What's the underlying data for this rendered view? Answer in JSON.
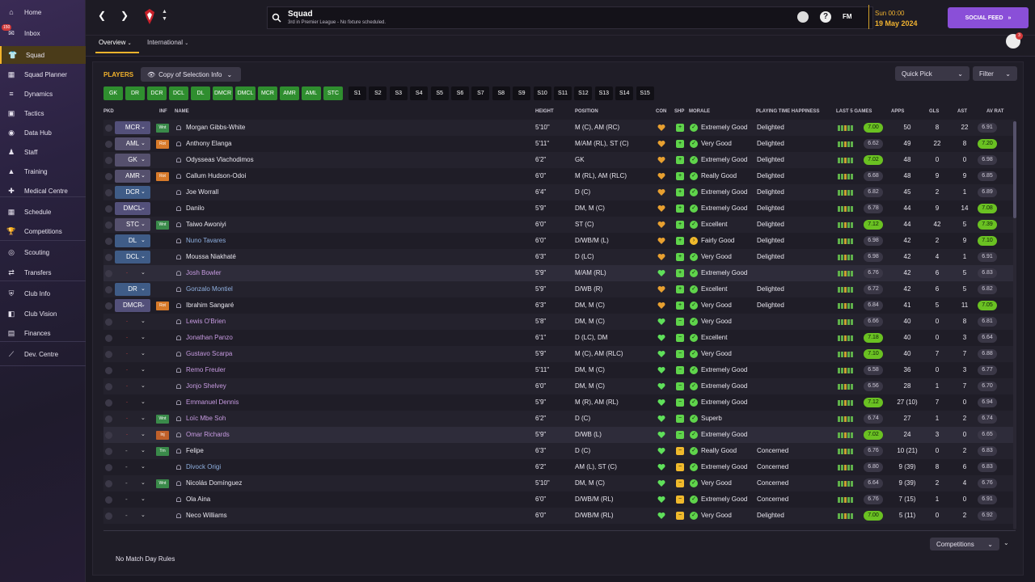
{
  "sidebar": {
    "items": [
      {
        "label": "Home",
        "icon": "home-icon"
      },
      {
        "label": "Inbox",
        "icon": "inbox-icon",
        "badge": "150"
      },
      {
        "label": "Squad",
        "icon": "squad-icon",
        "active": true
      },
      {
        "label": "Squad Planner",
        "icon": "squad-planner-icon"
      },
      {
        "label": "Dynamics",
        "icon": "dynamics-icon"
      },
      {
        "label": "Tactics",
        "icon": "tactics-icon"
      },
      {
        "label": "Data Hub",
        "icon": "data-hub-icon"
      },
      {
        "label": "Staff",
        "icon": "staff-icon"
      },
      {
        "label": "Training",
        "icon": "training-icon"
      },
      {
        "label": "Medical Centre",
        "icon": "medical-icon"
      },
      {
        "label": "Schedule",
        "icon": "schedule-icon"
      },
      {
        "label": "Competitions",
        "icon": "trophy-icon"
      },
      {
        "label": "Scouting",
        "icon": "scouting-icon"
      },
      {
        "label": "Transfers",
        "icon": "transfers-icon"
      },
      {
        "label": "Club Info",
        "icon": "club-info-icon"
      },
      {
        "label": "Club Vision",
        "icon": "club-vision-icon"
      },
      {
        "label": "Finances",
        "icon": "finances-icon"
      },
      {
        "label": "Dev. Centre",
        "icon": "dev-centre-icon"
      }
    ]
  },
  "header": {
    "title": "Squad",
    "subtitle": "3rd in Premier League - No fixture scheduled.",
    "fm_label": "FM",
    "date_line1": "Sun 00:00",
    "date_line2": "19 May 2024",
    "social_feed": "SOCIAL FEED",
    "notif_count": "3"
  },
  "tabs": {
    "overview": "Overview",
    "international": "International"
  },
  "panel": {
    "players_label": "PLAYERS",
    "selection_info": "Copy of Selection Info",
    "quick_pick": "Quick Pick",
    "filter": "Filter",
    "competitions": "Competitions",
    "footer_text": "No Match Day Rules"
  },
  "formation_buttons": [
    "GK",
    "DR",
    "DCR",
    "DCL",
    "DL",
    "DMCR",
    "DMCL",
    "MCR",
    "AMR",
    "AML",
    "STC"
  ],
  "sub_buttons": [
    "S1",
    "S2",
    "S3",
    "S4",
    "S5",
    "S6",
    "S7",
    "S8",
    "S9",
    "S10",
    "S11",
    "S12",
    "S13",
    "S14",
    "S15"
  ],
  "columns": {
    "pkd": "PKD",
    "inf": "INF",
    "name": "NAME",
    "height": "HEIGHT",
    "position": "POSITION",
    "con": "CON",
    "shp": "SHP",
    "morale": "MORALE",
    "pth": "PLAYING TIME HAPPINESS",
    "last5": "LAST 5 GAMES",
    "apps": "APPS",
    "gls": "GLS",
    "ast": "AST",
    "avrat": "AV RAT"
  },
  "colors": {
    "accent": "#f3b32c",
    "social": "#8a4fd8",
    "pos_defense": "#3f5c87",
    "pos_mid": "#53507a",
    "pos_attack": "#55506d",
    "green": "#2f8e2f",
    "rating_green": "#6ac122"
  },
  "players": [
    {
      "pkd": "MCR",
      "inf": "Wnt",
      "name": "Morgan Gibbs-White",
      "height": "5'10\"",
      "position": "M (C), AM (RC)",
      "morale": "Extremely Good",
      "pth": "Delighted",
      "rating": "7.00",
      "rating_hi": true,
      "apps": "50",
      "gls": "8",
      "ast": "22",
      "avrat": "6.91",
      "avrat_hi": false
    },
    {
      "pkd": "AML",
      "inf": "Rot",
      "name": "Anthony Elanga",
      "height": "5'11\"",
      "position": "M/AM (RL), ST (C)",
      "morale": "Very Good",
      "pth": "Delighted",
      "rating": "6.62",
      "rating_hi": false,
      "apps": "49",
      "gls": "22",
      "ast": "8",
      "avrat": "7.20",
      "avrat_hi": true
    },
    {
      "pkd": "GK",
      "inf": "",
      "name": "Odysseas Vlachodimos",
      "height": "6'2\"",
      "position": "GK",
      "morale": "Extremely Good",
      "pth": "Delighted",
      "rating": "7.02",
      "rating_hi": true,
      "apps": "48",
      "gls": "0",
      "ast": "0",
      "avrat": "6.98",
      "avrat_hi": false
    },
    {
      "pkd": "AMR",
      "inf": "Rot",
      "name": "Callum Hudson-Odoi",
      "height": "6'0\"",
      "position": "M (RL), AM (RLC)",
      "morale": "Really Good",
      "pth": "Delighted",
      "rating": "6.68",
      "rating_hi": false,
      "apps": "48",
      "gls": "9",
      "ast": "9",
      "avrat": "6.85",
      "avrat_hi": false
    },
    {
      "pkd": "DCR",
      "inf": "",
      "name": "Joe Worrall",
      "height": "6'4\"",
      "position": "D (C)",
      "morale": "Extremely Good",
      "pth": "Delighted",
      "rating": "6.82",
      "rating_hi": false,
      "apps": "45",
      "gls": "2",
      "ast": "1",
      "avrat": "6.89",
      "avrat_hi": false
    },
    {
      "pkd": "DMCL",
      "inf": "",
      "name": "Danilo",
      "height": "5'9\"",
      "position": "DM, M (C)",
      "morale": "Extremely Good",
      "pth": "Delighted",
      "rating": "6.78",
      "rating_hi": false,
      "apps": "44",
      "gls": "9",
      "ast": "14",
      "avrat": "7.08",
      "avrat_hi": true
    },
    {
      "pkd": "STC",
      "inf": "Wnt",
      "name": "Taiwo Awoniyi",
      "height": "6'0\"",
      "position": "ST (C)",
      "morale": "Excellent",
      "pth": "Delighted",
      "rating": "7.12",
      "rating_hi": true,
      "apps": "44",
      "gls": "42",
      "ast": "5",
      "avrat": "7.39",
      "avrat_hi": true
    },
    {
      "pkd": "DL",
      "inf": "",
      "name": "Nuno Tavares",
      "height": "6'0\"",
      "position": "D/WB/M (L)",
      "morale": "Fairly Good",
      "pth": "Delighted",
      "rating": "6.98",
      "rating_hi": false,
      "apps": "42",
      "gls": "2",
      "ast": "9",
      "avrat": "7.10",
      "avrat_hi": true,
      "loan": true
    },
    {
      "pkd": "DCL",
      "inf": "",
      "name": "Moussa Niakhaté",
      "height": "6'3\"",
      "position": "D (LC)",
      "morale": "Very Good",
      "pth": "Delighted",
      "rating": "6.98",
      "rating_hi": false,
      "apps": "42",
      "gls": "4",
      "ast": "1",
      "avrat": "6.91",
      "avrat_hi": false
    },
    {
      "pkd": "",
      "inf": "",
      "name": "Josh Bowler",
      "height": "5'9\"",
      "position": "M/AM (RL)",
      "morale": "Extremely Good",
      "pth": "",
      "rating": "6.76",
      "rating_hi": false,
      "apps": "42",
      "gls": "6",
      "ast": "5",
      "avrat": "6.83",
      "avrat_hi": false,
      "loan": true
    },
    {
      "pkd": "DR",
      "inf": "",
      "name": "Gonzalo Montiel",
      "height": "5'9\"",
      "position": "D/WB (R)",
      "morale": "Excellent",
      "pth": "Delighted",
      "rating": "6.72",
      "rating_hi": false,
      "apps": "42",
      "gls": "6",
      "ast": "5",
      "avrat": "6.82",
      "avrat_hi": false,
      "loan": true
    },
    {
      "pkd": "DMCR",
      "inf": "Rot",
      "name": "Ibrahim Sangaré",
      "height": "6'3\"",
      "position": "DM, M (C)",
      "morale": "Very Good",
      "pth": "Delighted",
      "rating": "6.84",
      "rating_hi": false,
      "apps": "41",
      "gls": "5",
      "ast": "11",
      "avrat": "7.05",
      "avrat_hi": true
    },
    {
      "pkd": "",
      "inf": "",
      "name": "Lewis O'Brien",
      "height": "5'8\"",
      "position": "DM, M (C)",
      "morale": "Very Good",
      "pth": "",
      "rating": "6.66",
      "rating_hi": false,
      "apps": "40",
      "gls": "0",
      "ast": "8",
      "avrat": "6.81",
      "avrat_hi": false,
      "loan": true
    },
    {
      "pkd": "",
      "inf": "",
      "name": "Jonathan Panzo",
      "height": "6'1\"",
      "position": "D (LC), DM",
      "morale": "Excellent",
      "pth": "",
      "rating": "7.18",
      "rating_hi": true,
      "apps": "40",
      "gls": "0",
      "ast": "3",
      "avrat": "6.64",
      "avrat_hi": false,
      "loan": true
    },
    {
      "pkd": "",
      "inf": "",
      "name": "Gustavo Scarpa",
      "height": "5'9\"",
      "position": "M (C), AM (RLC)",
      "morale": "Very Good",
      "pth": "",
      "rating": "7.10",
      "rating_hi": true,
      "apps": "40",
      "gls": "7",
      "ast": "7",
      "avrat": "6.88",
      "avrat_hi": false,
      "loan": true
    },
    {
      "pkd": "",
      "inf": "",
      "name": "Remo Freuler",
      "height": "5'11\"",
      "position": "DM, M (C)",
      "morale": "Extremely Good",
      "pth": "",
      "rating": "6.58",
      "rating_hi": false,
      "apps": "36",
      "gls": "0",
      "ast": "3",
      "avrat": "6.77",
      "avrat_hi": false,
      "loan": true
    },
    {
      "pkd": "",
      "inf": "",
      "name": "Jonjo Shelvey",
      "height": "6'0\"",
      "position": "DM, M (C)",
      "morale": "Extremely Good",
      "pth": "",
      "rating": "6.56",
      "rating_hi": false,
      "apps": "28",
      "gls": "1",
      "ast": "7",
      "avrat": "6.70",
      "avrat_hi": false,
      "loan": true
    },
    {
      "pkd": "",
      "inf": "",
      "name": "Emmanuel Dennis",
      "height": "5'9\"",
      "position": "M (R), AM (RL)",
      "morale": "Extremely Good",
      "pth": "",
      "rating": "7.12",
      "rating_hi": true,
      "apps": "27 (10)",
      "gls": "7",
      "ast": "0",
      "avrat": "6.94",
      "avrat_hi": false,
      "loan": true
    },
    {
      "pkd": "",
      "inf": "Wnt",
      "name": "Loïc Mbe Soh",
      "height": "6'2\"",
      "position": "D (C)",
      "morale": "Superb",
      "pth": "",
      "rating": "6.74",
      "rating_hi": false,
      "apps": "27",
      "gls": "1",
      "ast": "2",
      "avrat": "6.74",
      "avrat_hi": false,
      "loan": true
    },
    {
      "pkd": "",
      "inf": "Inj",
      "name": "Omar Richards",
      "height": "5'9\"",
      "position": "D/WB (L)",
      "morale": "Extremely Good",
      "pth": "",
      "rating": "7.02",
      "rating_hi": true,
      "apps": "24",
      "gls": "3",
      "ast": "0",
      "avrat": "6.65",
      "avrat_hi": false,
      "loan": true
    },
    {
      "pkd": "-",
      "inf": "Trn",
      "name": "Felipe",
      "height": "6'3\"",
      "position": "D (C)",
      "morale": "Really Good",
      "pth": "Concerned",
      "rating": "6.76",
      "rating_hi": false,
      "apps": "10 (21)",
      "gls": "0",
      "ast": "2",
      "avrat": "6.83",
      "avrat_hi": false
    },
    {
      "pkd": "-",
      "inf": "",
      "name": "Divock Origi",
      "height": "6'2\"",
      "position": "AM (L), ST (C)",
      "morale": "Extremely Good",
      "pth": "Concerned",
      "rating": "6.80",
      "rating_hi": false,
      "apps": "9 (39)",
      "gls": "8",
      "ast": "6",
      "avrat": "6.83",
      "avrat_hi": false,
      "loan2": true
    },
    {
      "pkd": "-",
      "inf": "Wnt",
      "name": "Nicolás Domínguez",
      "height": "5'10\"",
      "position": "DM, M (C)",
      "morale": "Very Good",
      "pth": "Concerned",
      "rating": "6.64",
      "rating_hi": false,
      "apps": "9 (39)",
      "gls": "2",
      "ast": "4",
      "avrat": "6.76",
      "avrat_hi": false
    },
    {
      "pkd": "-",
      "inf": "",
      "name": "Ola Aina",
      "height": "6'0\"",
      "position": "D/WB/M (RL)",
      "morale": "Extremely Good",
      "pth": "Concerned",
      "rating": "6.76",
      "rating_hi": false,
      "apps": "7 (15)",
      "gls": "1",
      "ast": "0",
      "avrat": "6.91",
      "avrat_hi": false
    },
    {
      "pkd": "-",
      "inf": "",
      "name": "Neco Williams",
      "height": "6'0\"",
      "position": "D/WB/M (RL)",
      "morale": "Very Good",
      "pth": "Delighted",
      "rating": "7.00",
      "rating_hi": true,
      "apps": "5 (11)",
      "gls": "0",
      "ast": "2",
      "avrat": "6.92",
      "avrat_hi": false
    }
  ]
}
